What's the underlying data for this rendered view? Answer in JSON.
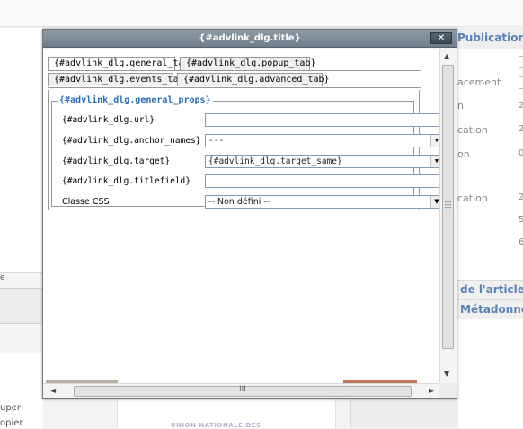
{
  "background": {
    "right_panel": {
      "header": "Publication",
      "labels": [
        "acement",
        "n",
        "cation",
        "on",
        "cation"
      ],
      "values": [
        "2",
        "2",
        "0",
        "2",
        "5",
        "6"
      ],
      "sections": [
        "de l'article",
        "Métadonnée"
      ]
    },
    "editor": {
      "snippet": "e",
      "actions": [
        "uper",
        "opier"
      ]
    },
    "footer_logo_text": "UNION NATIONALE DES"
  },
  "dialog": {
    "title": "{#advlink_dlg.title}",
    "close_label": "✕",
    "tabs": [
      {
        "label": "{#advlink_dlg.general_tab}",
        "active": true
      },
      {
        "label": "{#advlink_dlg.popup_tab}",
        "active": false
      },
      {
        "label": "{#advlink_dlg.events_tab}",
        "active": false
      },
      {
        "label": "{#advlink_dlg.advanced_tab}",
        "active": false
      }
    ],
    "fieldset_legend": "{#advlink_dlg.general_props}",
    "fields": {
      "url": {
        "label": "{#advlink_dlg.url}",
        "value": ""
      },
      "anchor_names": {
        "label": "{#advlink_dlg.anchor_names}",
        "value": "---"
      },
      "target": {
        "label": "{#advlink_dlg.target}",
        "value": "{#advlink_dlg.target_same}"
      },
      "titlefield": {
        "label": "{#advlink_dlg.titlefield}",
        "value": ""
      },
      "css_class": {
        "label": "Classe CSS",
        "value": "-- Non défini --"
      }
    },
    "scroll": {
      "up_icon": "▲",
      "down_icon": "▼",
      "left_icon": "◄",
      "right_icon": "►",
      "grip_h": "III"
    },
    "select_arrow": "▼"
  }
}
